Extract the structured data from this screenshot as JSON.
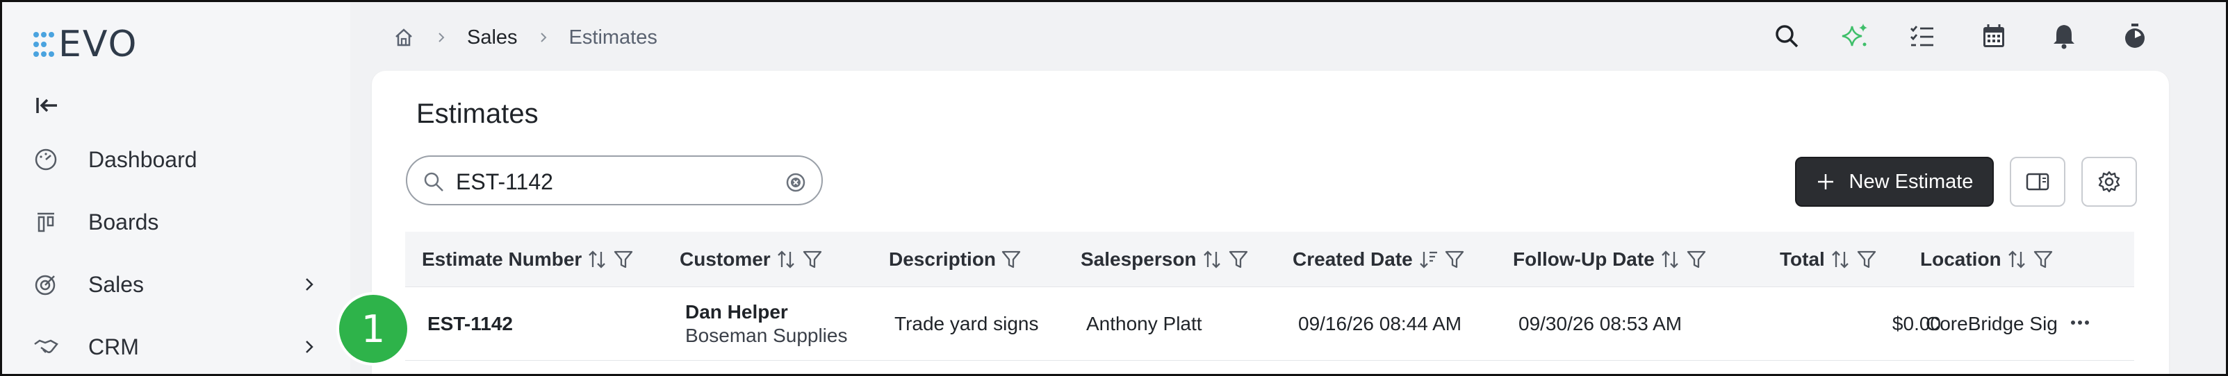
{
  "app": {
    "name": "EVO"
  },
  "sidebar": {
    "items": [
      {
        "label": "Dashboard",
        "icon": "gauge-icon",
        "has_chevron": false
      },
      {
        "label": "Boards",
        "icon": "board-icon",
        "has_chevron": false
      },
      {
        "label": "Sales",
        "icon": "target-icon",
        "has_chevron": true
      },
      {
        "label": "CRM",
        "icon": "handshake-icon",
        "has_chevron": true
      }
    ]
  },
  "breadcrumb": {
    "items": [
      "Sales",
      "Estimates"
    ]
  },
  "page": {
    "title": "Estimates"
  },
  "search": {
    "value": "EST-1142"
  },
  "toolbar": {
    "new_label": "New Estimate"
  },
  "table": {
    "columns": [
      "Estimate Number",
      "Customer",
      "Description",
      "Salesperson",
      "Created Date",
      "Follow-Up Date",
      "Total",
      "Location"
    ],
    "rows": [
      {
        "estimate_number": "EST-1142",
        "customer_name": "Dan Helper",
        "customer_company": "Boseman Supplies",
        "description": "Trade yard signs",
        "salesperson": "Anthony Platt",
        "created_date": "09/16/26 08:44 AM",
        "follow_up_date": "09/30/26 08:53 AM",
        "total": "$0.00",
        "location": "CoreBridge Signs"
      }
    ]
  },
  "step_badge": "1",
  "colors": {
    "brand": "#4aa3df",
    "accent_spark": "#3fbf6a",
    "primary_button": "#2b2d31",
    "badge": "#2eb34a"
  }
}
